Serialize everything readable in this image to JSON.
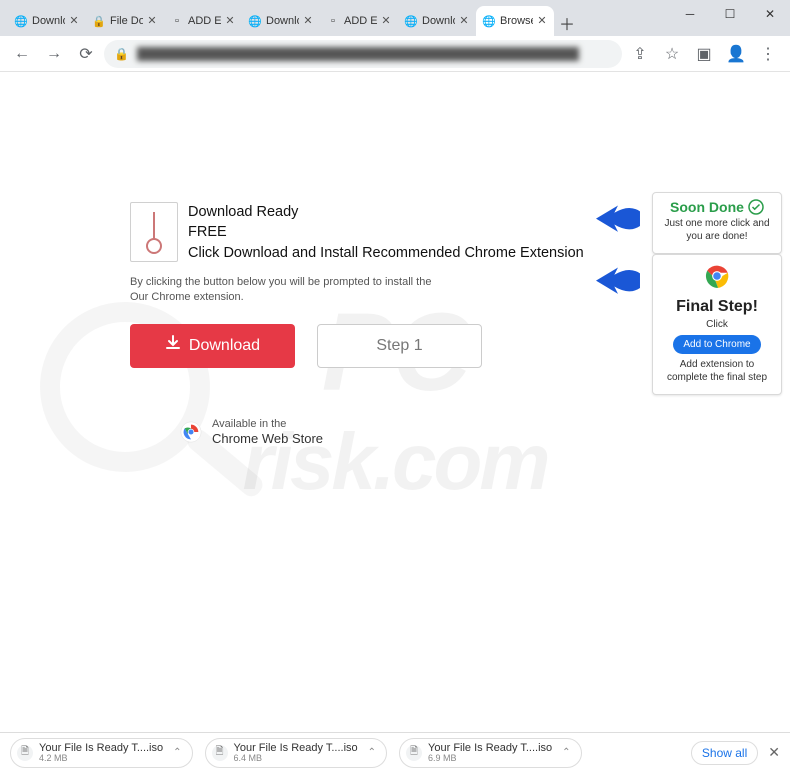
{
  "browser": {
    "tabs": [
      {
        "title": "Downlo",
        "favicon": "globe"
      },
      {
        "title": "File Dow",
        "favicon": "lock"
      },
      {
        "title": "ADD EX",
        "favicon": "blank"
      },
      {
        "title": "Downlo",
        "favicon": "globe"
      },
      {
        "title": "ADD EX",
        "favicon": "blank"
      },
      {
        "title": "Downlo",
        "favicon": "globe"
      },
      {
        "title": "Browse",
        "favicon": "globe",
        "active": true
      }
    ],
    "url_blurred": "████████████████████████████████████████████████████"
  },
  "page": {
    "heading_line1": "Download Ready",
    "heading_line2": "FREE",
    "heading_line3": "Click Download and Install Recommended Chrome Extension",
    "disclaimer_line1": "By clicking the button below you will be prompted to install the",
    "disclaimer_line2": "Our Chrome extension.",
    "download_label": "Download",
    "step_label": "Step 1",
    "store_small": "Available in the",
    "store_big": "Chrome Web Store"
  },
  "popup1": {
    "title": "Soon Done",
    "sub": "Just one more click and you are done!"
  },
  "popup2": {
    "title": "Final Step!",
    "click": "Click",
    "button": "Add to Chrome",
    "sub": "Add extension to complete the final step"
  },
  "downloads": {
    "items": [
      {
        "name": "Your File Is Ready T....iso",
        "size": "4.2 MB"
      },
      {
        "name": "Your File Is Ready T....iso",
        "size": "6.4 MB"
      },
      {
        "name": "Your File Is Ready T....iso",
        "size": "6.9 MB"
      }
    ],
    "show_all": "Show all"
  },
  "watermark": {
    "line1": "PC",
    "line2": "risk.com"
  }
}
